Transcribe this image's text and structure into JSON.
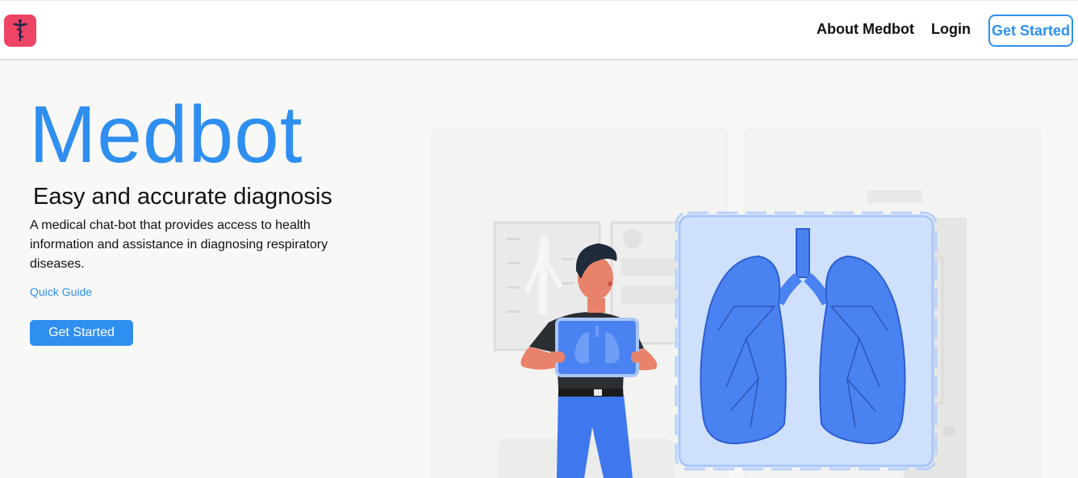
{
  "colors": {
    "accent": "#2f8ff0",
    "logo_bg": "#ee4466",
    "page_bg": "#f8f8f7"
  },
  "navbar": {
    "logo_icon": "caduceus-icon",
    "links": [
      "About Medbot",
      "Login"
    ],
    "cta_label": "Get Started"
  },
  "hero": {
    "title": "Medbot",
    "subtitle": "Easy and accurate diagnosis",
    "description": "A medical chat-bot that provides access to health information and assistance in diagnosing respiratory diseases.",
    "quick_guide": "Quick Guide",
    "cta_label": "Get Started"
  },
  "illustration": {
    "icon": "lungs-xray-illustration"
  }
}
